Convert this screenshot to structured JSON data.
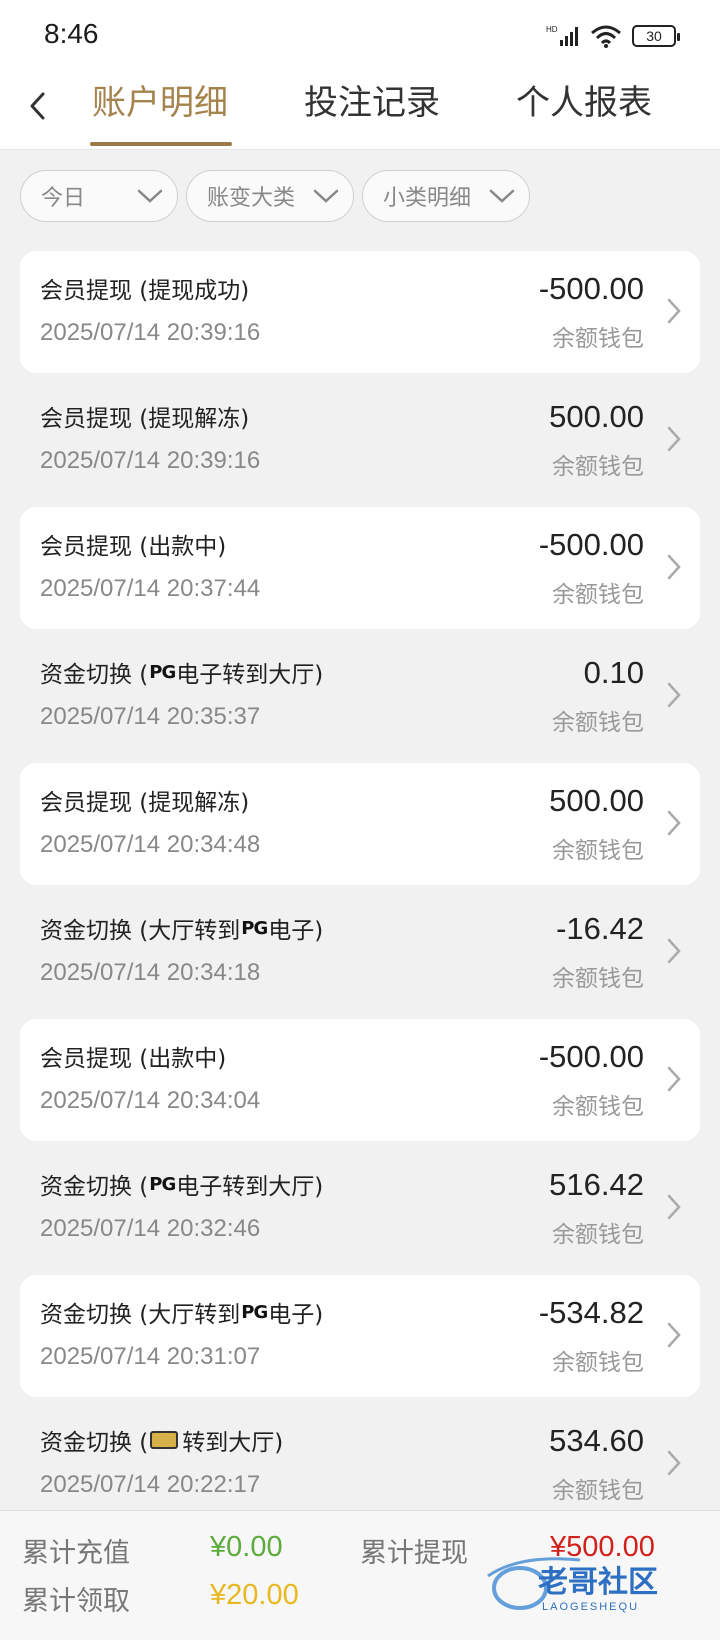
{
  "status_bar": {
    "time": "8:46",
    "battery": "30"
  },
  "nav": {
    "tabs": [
      {
        "label": "账户明细",
        "active": true
      },
      {
        "label": "投注记录",
        "active": false
      },
      {
        "label": "个人报表",
        "active": false
      }
    ]
  },
  "filters": [
    {
      "label": "今日"
    },
    {
      "label": "账变大类"
    },
    {
      "label": "小类明细"
    }
  ],
  "records": [
    {
      "title": "会员提现 (提现成功)",
      "time": "2025/07/14 20:39:16",
      "amount": "-500.00",
      "wallet": "余额钱包"
    },
    {
      "title": "会员提现 (提现解冻)",
      "time": "2025/07/14 20:39:16",
      "amount": "500.00",
      "wallet": "余额钱包"
    },
    {
      "title": "会员提现 (出款中)",
      "time": "2025/07/14 20:37:44",
      "amount": "-500.00",
      "wallet": "余额钱包"
    },
    {
      "title_prefix": "资金切换 (",
      "logo": "PG",
      "title_suffix": "电子转到大厅)",
      "time": "2025/07/14 20:35:37",
      "amount": "0.10",
      "wallet": "余额钱包"
    },
    {
      "title": "会员提现 (提现解冻)",
      "time": "2025/07/14 20:34:48",
      "amount": "500.00",
      "wallet": "余额钱包"
    },
    {
      "title_prefix": "资金切换 (大厅转到",
      "logo": "PG",
      "title_suffix": "电子)",
      "time": "2025/07/14 20:34:18",
      "amount": "-16.42",
      "wallet": "余额钱包"
    },
    {
      "title": "会员提现 (出款中)",
      "time": "2025/07/14 20:34:04",
      "amount": "-500.00",
      "wallet": "余额钱包"
    },
    {
      "title_prefix": "资金切换 (",
      "logo": "PG",
      "title_suffix": "电子转到大厅)",
      "time": "2025/07/14 20:32:46",
      "amount": "516.42",
      "wallet": "余额钱包"
    },
    {
      "title_prefix": "资金切换 (大厅转到",
      "logo": "PG",
      "title_suffix": "电子)",
      "time": "2025/07/14 20:31:07",
      "amount": "-534.82",
      "wallet": "余额钱包"
    },
    {
      "title_prefix": "资金切换 (",
      "logo": "",
      "title_suffix": "转到大厅)",
      "time": "2025/07/14 20:22:17",
      "amount": "534.60",
      "wallet": "余额钱包"
    }
  ],
  "footer": {
    "recharge_label": "累计充值",
    "recharge_value": "¥0.00",
    "withdraw_label": "累计提现",
    "withdraw_value": "¥500.00",
    "claim_label": "累计领取",
    "claim_value": "¥20.00"
  },
  "watermark": {
    "text": "老哥社区",
    "subtext": "LAOGESHEQU"
  },
  "colors": {
    "accent": "#a4834d",
    "recharge": "#5cab3c",
    "withdraw": "#d0211c",
    "claim": "#e8b820"
  }
}
